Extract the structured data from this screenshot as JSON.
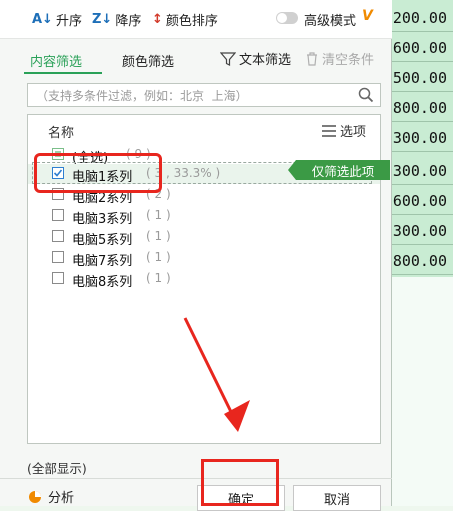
{
  "sort_bar": {
    "ascending": "升序",
    "descending": "降序",
    "color_sort": "颜色排序",
    "advanced_mode": "高级模式",
    "advanced_mark": "V"
  },
  "tabs": {
    "content_filter": "内容筛选",
    "color_filter": "颜色筛选",
    "text_filter": "文本筛选",
    "clear_conditions": "清空条件"
  },
  "search": {
    "placeholder": "（支持多条件过滤，例如：北京  上海）"
  },
  "list": {
    "header_name": "名称",
    "header_options": "选项",
    "items": [
      {
        "label": "(全选)",
        "count": "( 9 )",
        "state": "partial"
      },
      {
        "label": "电脑1系列",
        "count": "( 3 , 33.3% )",
        "state": "checked"
      },
      {
        "label": "电脑2系列",
        "count": "( 2 )",
        "state": "unchecked"
      },
      {
        "label": "电脑3系列",
        "count": "( 1 )",
        "state": "unchecked"
      },
      {
        "label": "电脑5系列",
        "count": "( 1 )",
        "state": "unchecked"
      },
      {
        "label": "电脑7系列",
        "count": "( 1 )",
        "state": "unchecked"
      },
      {
        "label": "电脑8系列",
        "count": "( 1 )",
        "state": "unchecked"
      }
    ],
    "only_filter_this": "仅筛选此项"
  },
  "footer": {
    "show_all": "(全部显示)",
    "analysis": "分析",
    "ok": "确定",
    "cancel": "取消"
  },
  "sheet": {
    "cells": [
      "200.00",
      "600.00",
      "500.00",
      "800.00",
      "300.00",
      "300.00",
      "600.00",
      "300.00",
      "800.00"
    ]
  },
  "colors": {
    "accent_green": "#2aa158",
    "tag_green": "#3b9a45",
    "annotation_red": "#e8261e",
    "icon_blue": "#1e6fb8"
  }
}
